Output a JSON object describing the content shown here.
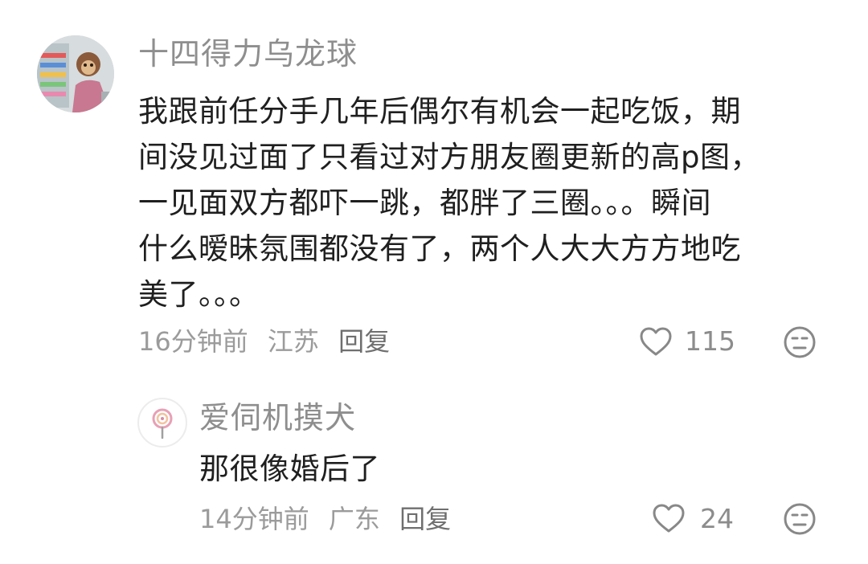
{
  "comment": {
    "username": "十四得力乌龙球",
    "lines": [
      "我跟前任分手几年后偶尔有机会一起吃饭，期",
      "间没见过面了只看过对方朋友圈更新的高p图，",
      "一见面双方都吓一跳，都胖了三圈。。。瞬间",
      "什么暧昧氛围都没有了，两个人大大方方地吃",
      "美了。。。"
    ],
    "time": "16分钟前",
    "location": "江苏",
    "reply_label": "回复",
    "likes": "115",
    "heart_icon": "heart-outline-icon",
    "reaction_icon": "meh-face-icon"
  },
  "reply": {
    "username": "爱伺机摸犬",
    "text": "那很像婚后了",
    "time": "14分钟前",
    "location": "广东",
    "reply_label": "回复",
    "likes": "24",
    "heart_icon": "heart-outline-icon",
    "reaction_icon": "meh-face-icon"
  },
  "colors": {
    "username": "#8e8e8e",
    "text": "#1f1f1f",
    "meta": "#9b9b9b",
    "icon": "#888888"
  }
}
